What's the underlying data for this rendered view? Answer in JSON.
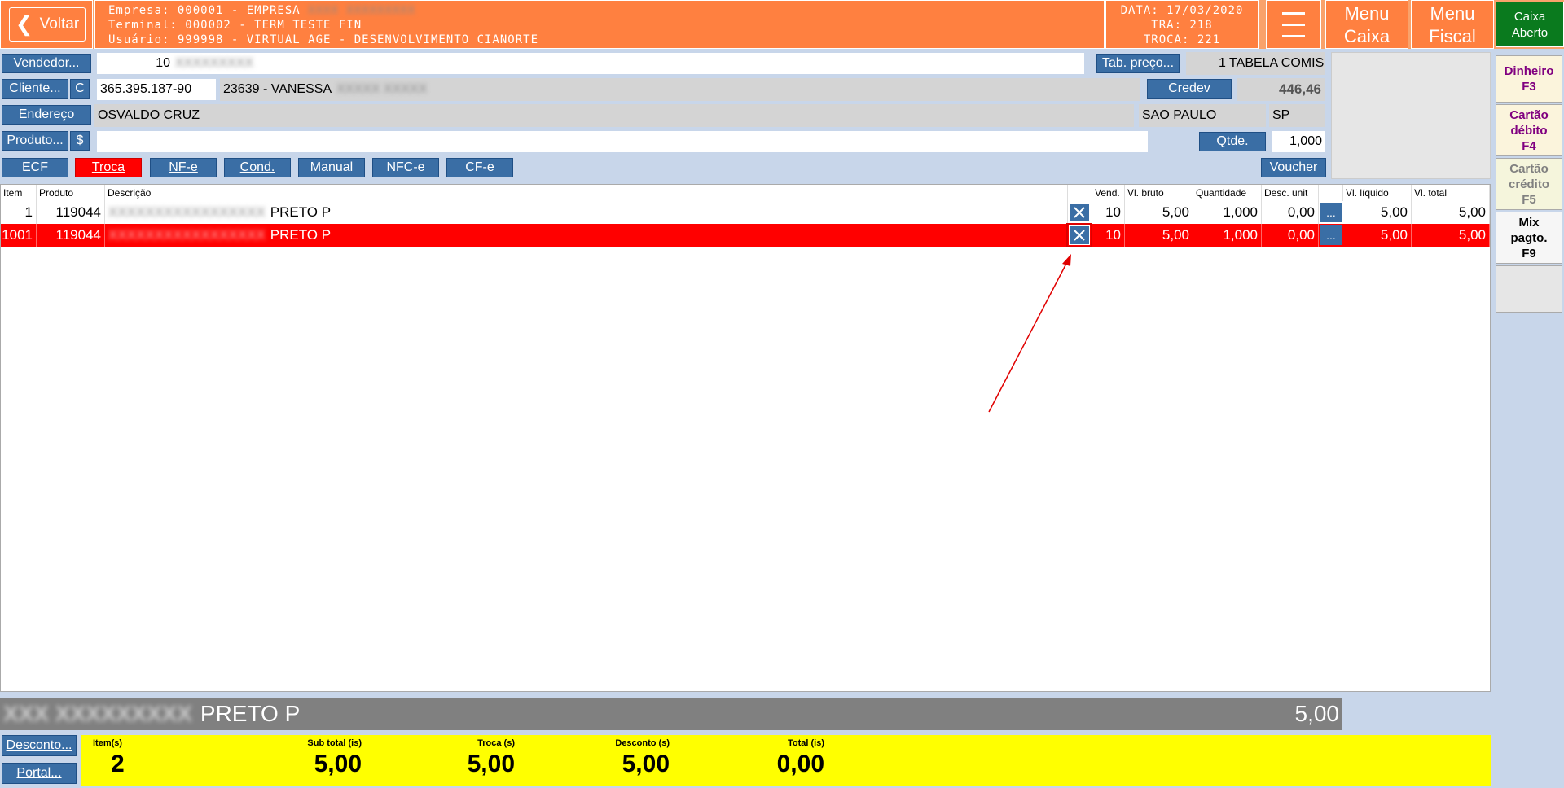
{
  "header": {
    "back_label": "Voltar",
    "empresa": "Empresa: 000001 - EMPRESA",
    "terminal": "Terminal: 000002 - TERM TESTE FIN",
    "usuario": "Usuário: 999998 - VIRTUAL AGE - DESENVOLVIMENTO CIANORTE",
    "data": "DATA: 17/03/2020",
    "tra": "TRA: 218",
    "troca": "TROCA: 221",
    "menu_caixa": [
      "Menu",
      "Caixa"
    ],
    "menu_fiscal": [
      "Menu",
      "Fiscal"
    ],
    "caixa_status": [
      "Caixa",
      "Aberto"
    ]
  },
  "form": {
    "vendedor_label": "Vendedor...",
    "vendedor_code": "10",
    "tab_preco_label": "Tab. preço...",
    "tabela": "1 TABELA COMIS",
    "cliente_label": "Cliente...",
    "cliente_c": "C",
    "cliente_cpf": "365.395.187-90",
    "cliente_name": "23639 - VANESSA",
    "credev_label": "Credev",
    "credev_value": "446,46",
    "endereco_label": "Endereço",
    "endereco": "OSVALDO CRUZ",
    "cidade": "SAO PAULO",
    "uf": "SP",
    "produto_label": "Produto...",
    "produto_dollar": "$",
    "produto_value": "",
    "qtde_label": "Qtde.",
    "qtde_value": "1,000",
    "voucher_label": "Voucher"
  },
  "modes": [
    "ECF",
    "Troca",
    "NF-e",
    "Cond.",
    "Manual",
    "NFC-e",
    "CF-e"
  ],
  "table": {
    "headers": [
      "Item",
      "Produto",
      "Descrição",
      "",
      "Vend.",
      "Vl. bruto",
      "Quantidade",
      "Desc. unit",
      "",
      "Vl. líquido",
      "Vl. total"
    ],
    "rows": [
      {
        "item": "1",
        "produto": "119044",
        "descricao": "PRETO P",
        "vend": "10",
        "bruto": "5,00",
        "qtd": "1,000",
        "desc": "0,00",
        "liquido": "5,00",
        "total": "5,00",
        "selected": false
      },
      {
        "item": "1001",
        "produto": "119044",
        "descricao": "PRETO P",
        "vend": "10",
        "bruto": "5,00",
        "qtd": "1,000",
        "desc": "0,00",
        "liquido": "5,00",
        "total": "5,00",
        "selected": true
      }
    ]
  },
  "payments": {
    "dinheiro": [
      "Dinheiro",
      "F3"
    ],
    "debito": [
      "Cartão",
      "débito",
      "F4"
    ],
    "credito": [
      "Cartão",
      "crédito",
      "F5"
    ],
    "mix": [
      "Mix",
      "pagto.",
      "F9"
    ]
  },
  "colors": {
    "dinheiro": "#800080",
    "debito": "#800080",
    "credito": "#808080",
    "mix": "#000000"
  },
  "bottom": {
    "desc_text": "PRETO P",
    "desc_value": "5,00",
    "desconto_label": "Desconto...",
    "portal_label": "Portal...",
    "totals": [
      {
        "label": "Item(s)",
        "value": "2"
      },
      {
        "label": "Sub total (is)",
        "value": "5,00"
      },
      {
        "label": "Troca (s)",
        "value": "5,00"
      },
      {
        "label": "Desconto (s)",
        "value": "5,00"
      },
      {
        "label": "Total (is)",
        "value": "0,00"
      }
    ]
  }
}
